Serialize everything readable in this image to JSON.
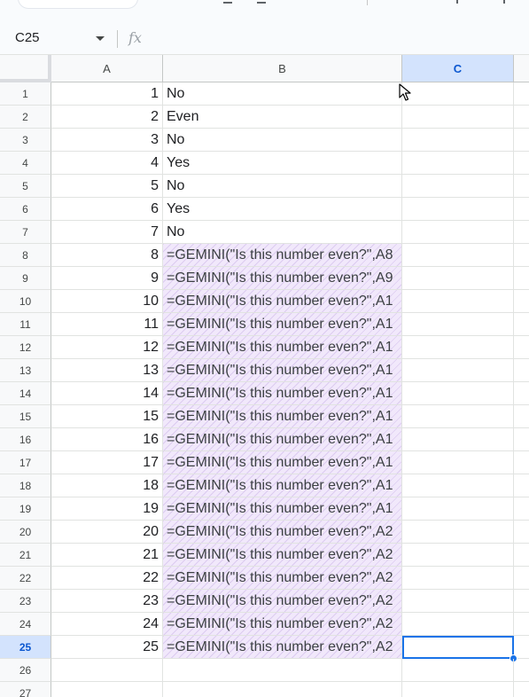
{
  "formula_bar": {
    "name_box": "C25",
    "fx_label": "fx",
    "formula": ""
  },
  "columns": [
    "A",
    "B",
    "C"
  ],
  "selected_column": "C",
  "selected_row": 25,
  "rows": [
    {
      "row": "1",
      "a": "1",
      "b": "No",
      "formula": false
    },
    {
      "row": "2",
      "a": "2",
      "b": "Even",
      "formula": false
    },
    {
      "row": "3",
      "a": "3",
      "b": "No",
      "formula": false
    },
    {
      "row": "4",
      "a": "4",
      "b": "Yes",
      "formula": false
    },
    {
      "row": "5",
      "a": "5",
      "b": "No",
      "formula": false
    },
    {
      "row": "6",
      "a": "6",
      "b": "Yes",
      "formula": false
    },
    {
      "row": "7",
      "a": "7",
      "b": "No",
      "formula": false
    },
    {
      "row": "8",
      "a": "8",
      "b": "=GEMINI(\"Is this number even?\",A8",
      "formula": true
    },
    {
      "row": "9",
      "a": "9",
      "b": "=GEMINI(\"Is this number even?\",A9",
      "formula": true
    },
    {
      "row": "10",
      "a": "10",
      "b": "=GEMINI(\"Is this number even?\",A1",
      "formula": true
    },
    {
      "row": "11",
      "a": "11",
      "b": "=GEMINI(\"Is this number even?\",A1",
      "formula": true
    },
    {
      "row": "12",
      "a": "12",
      "b": "=GEMINI(\"Is this number even?\",A1",
      "formula": true
    },
    {
      "row": "13",
      "a": "13",
      "b": "=GEMINI(\"Is this number even?\",A1",
      "formula": true
    },
    {
      "row": "14",
      "a": "14",
      "b": "=GEMINI(\"Is this number even?\",A1",
      "formula": true
    },
    {
      "row": "15",
      "a": "15",
      "b": "=GEMINI(\"Is this number even?\",A1",
      "formula": true
    },
    {
      "row": "16",
      "a": "16",
      "b": "=GEMINI(\"Is this number even?\",A1",
      "formula": true
    },
    {
      "row": "17",
      "a": "17",
      "b": "=GEMINI(\"Is this number even?\",A1",
      "formula": true
    },
    {
      "row": "18",
      "a": "18",
      "b": "=GEMINI(\"Is this number even?\",A1",
      "formula": true
    },
    {
      "row": "19",
      "a": "19",
      "b": "=GEMINI(\"Is this number even?\",A1",
      "formula": true
    },
    {
      "row": "20",
      "a": "20",
      "b": "=GEMINI(\"Is this number even?\",A2",
      "formula": true
    },
    {
      "row": "21",
      "a": "21",
      "b": "=GEMINI(\"Is this number even?\",A2",
      "formula": true
    },
    {
      "row": "22",
      "a": "22",
      "b": "=GEMINI(\"Is this number even?\",A2",
      "formula": true
    },
    {
      "row": "23",
      "a": "23",
      "b": "=GEMINI(\"Is this number even?\",A2",
      "formula": true
    },
    {
      "row": "24",
      "a": "24",
      "b": "=GEMINI(\"Is this number even?\",A2",
      "formula": true
    },
    {
      "row": "25",
      "a": "25",
      "b": "=GEMINI(\"Is this number even?\",A2",
      "formula": true
    },
    {
      "row": "26",
      "a": "",
      "b": "",
      "formula": false
    },
    {
      "row": "27",
      "a": "",
      "b": "",
      "formula": false
    }
  ],
  "colors": {
    "selection": "#1a73e8",
    "header_selected_bg": "#d3e3fd",
    "formula_cell_bg": "#f1e8fb"
  }
}
